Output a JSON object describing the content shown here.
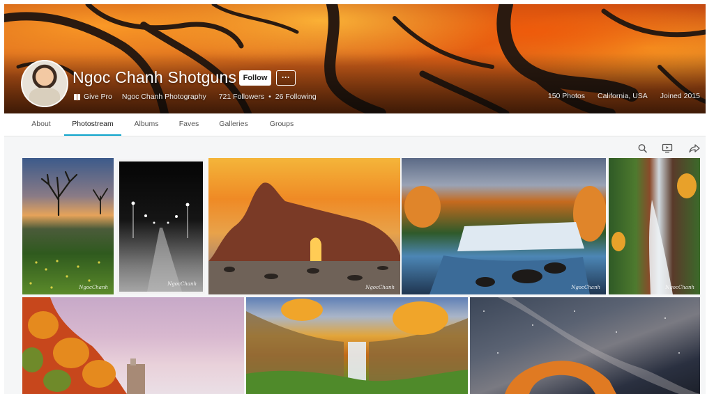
{
  "profile": {
    "name": "Ngoc Chanh Shotguns",
    "follow_label": "Follow",
    "more_label": "···",
    "give_pro": "Give Pro",
    "real_name": "Ngoc Chanh Photography",
    "followers": "721 Followers",
    "dot": "•",
    "following": "26 Following",
    "photos": "150 Photos",
    "location": "California, USA",
    "joined": "Joined 2015"
  },
  "tabs": [
    {
      "label": "About"
    },
    {
      "label": "Photostream"
    },
    {
      "label": "Albums"
    },
    {
      "label": "Faves"
    },
    {
      "label": "Galleries"
    },
    {
      "label": "Groups"
    }
  ],
  "active_tab": "Photostream",
  "toolbar": {
    "icons": [
      "search-icon",
      "slideshow-icon",
      "share-icon"
    ]
  },
  "photos": [
    {
      "name": "photo-sunset-trees",
      "watermark": "NgocChanh"
    },
    {
      "name": "photo-night-pier",
      "watermark": "NgocChanh"
    },
    {
      "name": "photo-keyhole-arch",
      "watermark": "NgocChanh"
    },
    {
      "name": "photo-autumn-waterfall",
      "watermark": "NgocChanh"
    },
    {
      "name": "photo-forest-cascade",
      "watermark": "NgocChanh"
    },
    {
      "name": "photo-lighthouse-cliff",
      "watermark": ""
    },
    {
      "name": "photo-canyon-falls",
      "watermark": ""
    },
    {
      "name": "photo-milky-way-arch",
      "watermark": ""
    }
  ],
  "colors": {
    "accent": "#0ea4cc",
    "tab_text": "#555555",
    "background": "#f5f6f7"
  }
}
